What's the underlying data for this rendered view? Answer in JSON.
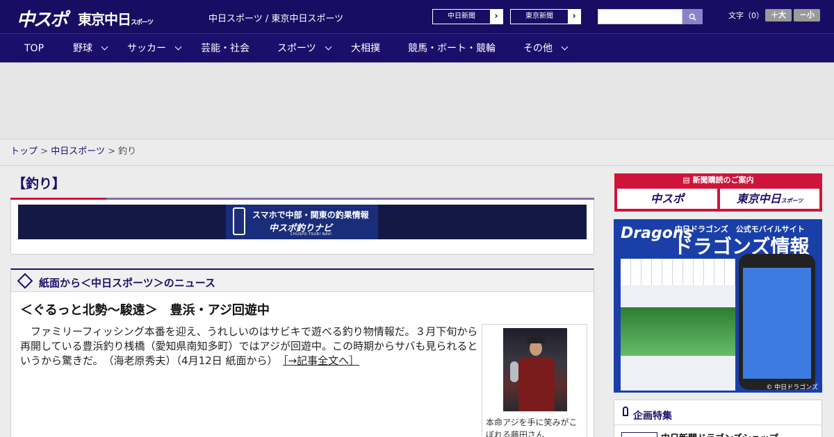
{
  "header": {
    "logo": "中スポ",
    "logo_tokyo": "東京中日",
    "logo_tokyo_small": "スポーツ",
    "title": "中日スポーツ / 東京中日スポーツ",
    "site_links": [
      {
        "label": "中日新聞"
      },
      {
        "label": "東京新聞"
      }
    ],
    "search_placeholder": "",
    "font_size_label": "文字（0）",
    "font_bigger": "＋大",
    "font_smaller": "－小"
  },
  "nav": {
    "items": [
      {
        "label": "TOP"
      },
      {
        "label": "野球"
      },
      {
        "label": "サッカー"
      },
      {
        "label": "芸能・社会"
      },
      {
        "label": "スポーツ"
      },
      {
        "label": "大相撲"
      },
      {
        "label": "競馬・ボート・競輪"
      },
      {
        "label": "その他"
      }
    ]
  },
  "breadcrumb": {
    "top": "トップ",
    "sep": ">",
    "chunichi": "中日スポーツ",
    "current": "釣り"
  },
  "section": {
    "title": "【釣り】"
  },
  "banner": {
    "line1": "スマホで中部・関東の釣果情報",
    "line2": "中スポ釣りナビ",
    "line3": "CHUSPO TSURI NAVI"
  },
  "news": {
    "header": "紙面から＜中日スポーツ＞のニュース",
    "headline": "＜ぐるっと北勢～駿遠＞　豊浜・アジ回遊中",
    "body": "　ファミリーフィッシング本番を迎え、うれしいのはサビキで遊べる釣り物情報だ。３月下旬から再開している豊浜釣り桟橋（愛知県南知多町）ではアジが回遊中。この時期からサバも見られるというから驚きだ。　（海老原秀夫）（4月12日 紙面から）",
    "more": "［→記事全文へ］",
    "photo_caption": "本命アジを手に笑みがこぼれる藤田さん"
  },
  "side": {
    "subscribe_header": "新聞購読のご案内",
    "subscribe_chuspo": "中スポ",
    "subscribe_tokyo": "東京中日",
    "subscribe_tokyo_small": "スポーツ",
    "dragons_logo": "Dragons",
    "dragons_sub": "中日ドラゴンズ　公式モバイルサイト",
    "dragons_title": "ドラゴンズ情報",
    "dragons_copyright": "© 中日ドラゴンズ",
    "kikaku_title": "企画特集",
    "kikaku_item": "中日新聞ドラゴンズショップ"
  }
}
